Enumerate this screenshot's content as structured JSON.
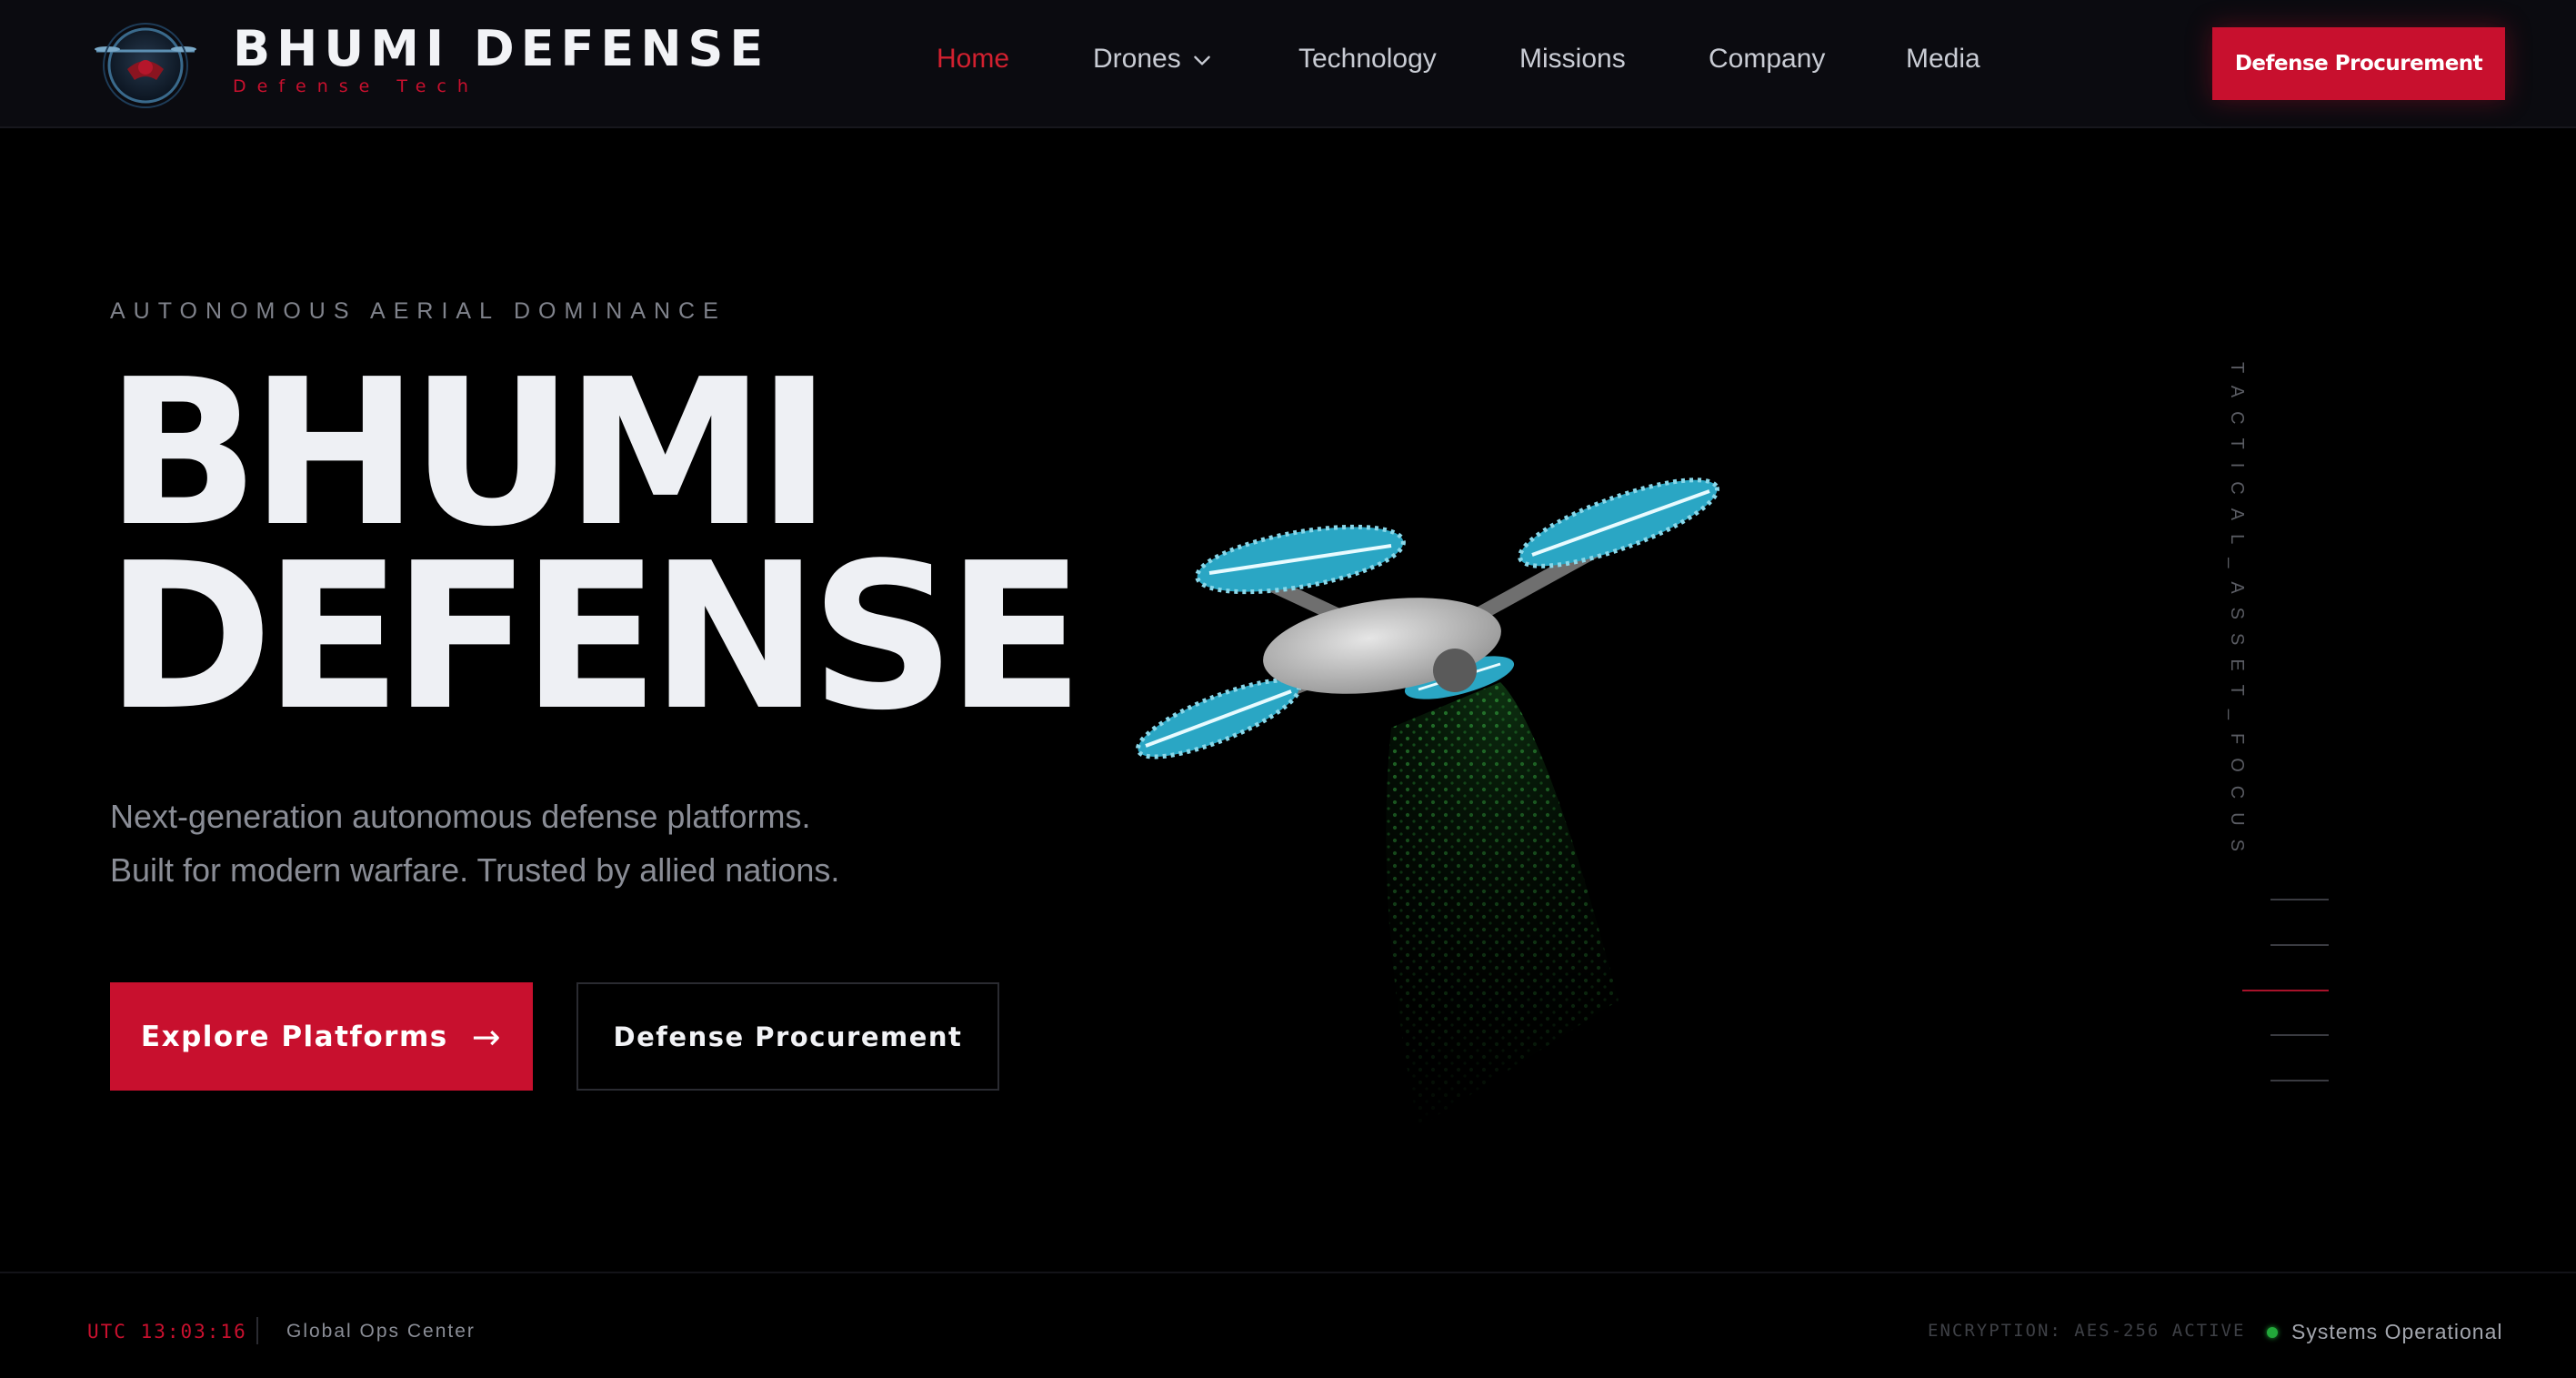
{
  "brand": {
    "name": "BHUMI DEFENSE",
    "tagline": "Defense Tech"
  },
  "nav": {
    "items": [
      {
        "label": "Home",
        "active": true
      },
      {
        "label": "Drones",
        "dropdown": true
      },
      {
        "label": "Technology"
      },
      {
        "label": "Missions"
      },
      {
        "label": "Company"
      },
      {
        "label": "Media"
      }
    ],
    "cta_label": "Defense Procurement"
  },
  "hero": {
    "eyebrow": "AUTONOMOUS AERIAL DOMINANCE",
    "title_line1": "BHUMI",
    "title_line2": "DEFENSE",
    "description_line1": "Next-generation autonomous defense platforms.",
    "description_line2": "Built for modern warfare. Trusted by allied nations.",
    "primary_button": "Explore Platforms",
    "primary_button_icon": "→",
    "secondary_button": "Defense Procurement"
  },
  "rail": {
    "label": "TACTICAL_ASSET_FOCUS",
    "active_index": 2,
    "tick_count": 5
  },
  "footer": {
    "utc_time": "UTC 13:03:16",
    "ops_center": "Global Ops Center",
    "encryption": "ENCRYPTION: AES-256 ACTIVE",
    "status": "Systems Operational"
  },
  "colors": {
    "accent": "#c8102e",
    "background": "#000000",
    "nav_background": "#0b0b10",
    "status_ok": "#22a83a",
    "rotor": "#2aa6c4"
  },
  "icons": {
    "logo": "drone-emblem-icon",
    "dropdown": "chevron-down-icon",
    "arrow": "arrow-right-icon",
    "status": "status-dot-icon"
  }
}
